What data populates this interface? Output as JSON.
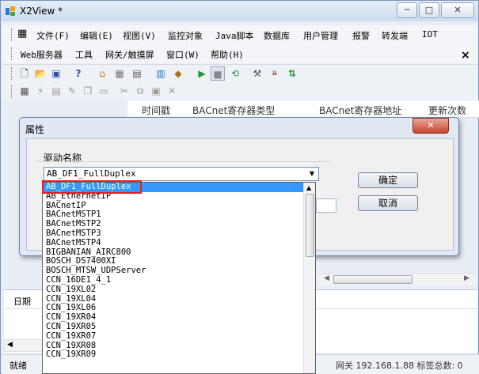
{
  "app": {
    "title": "X2View *",
    "min": "─",
    "max": "□",
    "close": "✕"
  },
  "menu": {
    "row1": [
      "文件(F)",
      "编辑(E)",
      "视图(V)",
      "监控对象",
      "Java脚本",
      "数据库",
      "用户管理",
      "报警",
      "转发端",
      "IOT"
    ],
    "row2": [
      "Web服务器",
      "工具",
      "网关/触摸屏",
      "窗口(W)",
      "帮助(H)"
    ],
    "mdi_close": "×"
  },
  "grid": {
    "columns": [
      "时间戳",
      "BACnet寄存器类型",
      "BACnet寄存器地址",
      "更新次数"
    ]
  },
  "log": {
    "header": "日期"
  },
  "status": {
    "left": "就绪",
    "right": "网关 192.168.1.88 标签总数: 0"
  },
  "dialog": {
    "title": "属性",
    "close": "✕",
    "group_label": "驱动名称",
    "combo_value": "AB_DF1_FullDuplex",
    "ok": "确定",
    "cancel": "取消"
  },
  "driver_list": {
    "selected_index": 0,
    "items": [
      "AB_DF1_FullDuplex",
      "AB_EthernetIP",
      "BACnetIP",
      "BACnetMSTP1",
      "BACnetMSTP2",
      "BACnetMSTP3",
      "BACnetMSTP4",
      "BIGBANIAN_AIRC800",
      "BOSCH_DS7400XI",
      "BOSCH_MTSW_UDPServer",
      "CCN_16DE1_4_1",
      "CCN_19XL02",
      "CCN_19XL04",
      "CCN_19XL06",
      "CCN_19XR04",
      "CCN_19XR05",
      "CCN_19XR07",
      "CCN_19XR08",
      "CCN_19XR09"
    ]
  },
  "colors": {
    "selection": "#3399ff",
    "highlight_box": "#e02020",
    "dialog_bg": "#dfe8f3"
  }
}
